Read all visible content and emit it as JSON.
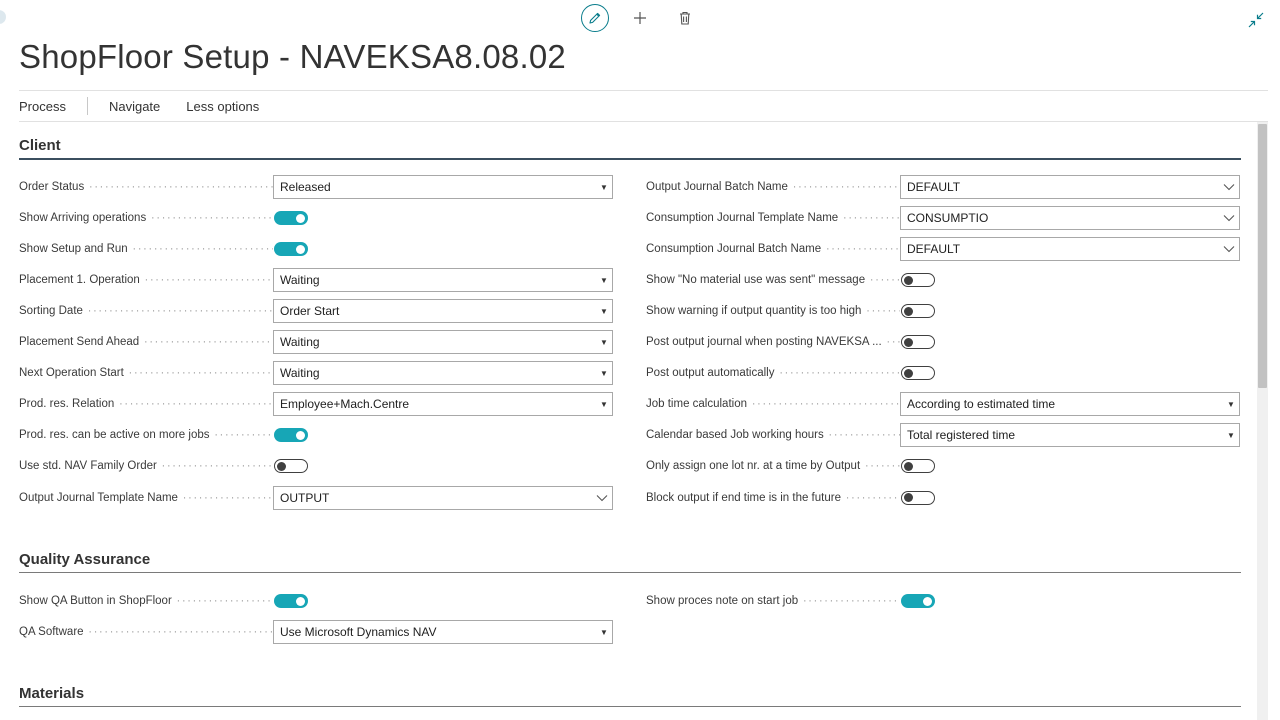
{
  "page": {
    "title": "ShopFloor Setup - NAVEKSA8.08.02"
  },
  "actions": {
    "edit": "edit-icon",
    "new": "plus-icon",
    "delete": "trash-icon",
    "collapse": "collapse-icon"
  },
  "menu": {
    "process": "Process",
    "navigate": "Navigate",
    "less_options": "Less options"
  },
  "colors": {
    "accent": "#17a6b6",
    "section_rule": "#3b4f5f"
  },
  "client": {
    "title": "Client",
    "left": [
      {
        "label": "Order Status",
        "type": "select",
        "value": "Released"
      },
      {
        "label": "Show Arriving operations",
        "type": "toggle",
        "value": "on"
      },
      {
        "label": "Show Setup and Run",
        "type": "toggle",
        "value": "on"
      },
      {
        "label": "Placement 1. Operation",
        "type": "select",
        "value": "Waiting"
      },
      {
        "label": "Sorting Date",
        "type": "select",
        "value": "Order Start"
      },
      {
        "label": "Placement Send Ahead",
        "type": "select",
        "value": "Waiting"
      },
      {
        "label": "Next Operation Start",
        "type": "select",
        "value": "Waiting"
      },
      {
        "label": "Prod. res. Relation",
        "type": "select",
        "value": "Employee+Mach.Centre"
      },
      {
        "label": "Prod. res. can be active on more jobs",
        "type": "toggle",
        "value": "on"
      },
      {
        "label": "Use std. NAV Family Order",
        "type": "toggle",
        "value": "off"
      },
      {
        "label": "Output Journal Template Name",
        "type": "lookup",
        "value": "OUTPUT"
      }
    ],
    "right": [
      {
        "label": "Output Journal Batch Name",
        "type": "lookup",
        "value": "DEFAULT"
      },
      {
        "label": "Consumption Journal Template Name",
        "type": "lookup",
        "value": "CONSUMPTIO"
      },
      {
        "label": "Consumption Journal Batch Name",
        "type": "lookup",
        "value": "DEFAULT"
      },
      {
        "label": "Show \"No material use was sent\" message",
        "type": "toggle",
        "value": "off"
      },
      {
        "label": "Show warning if output quantity is too high",
        "type": "toggle",
        "value": "off"
      },
      {
        "label": "Post output journal when posting NAVEKSA ...",
        "type": "toggle",
        "value": "off"
      },
      {
        "label": "Post output automatically",
        "type": "toggle",
        "value": "off"
      },
      {
        "label": "Job time calculation",
        "type": "select",
        "value": "According to estimated time"
      },
      {
        "label": "Calendar based Job working hours",
        "type": "select",
        "value": "Total registered time"
      },
      {
        "label": "Only assign one lot nr. at a time by Output",
        "type": "toggle",
        "value": "off"
      },
      {
        "label": "Block output if end time is in the future",
        "type": "toggle",
        "value": "off"
      }
    ]
  },
  "qa": {
    "title": "Quality Assurance",
    "left": [
      {
        "label": "Show QA Button in ShopFloor",
        "type": "toggle",
        "value": "on"
      },
      {
        "label": "QA Software",
        "type": "select",
        "value": "Use Microsoft Dynamics NAV"
      }
    ],
    "right": [
      {
        "label": "Show proces note on start job",
        "type": "toggle",
        "value": "on"
      }
    ]
  },
  "materials": {
    "title": "Materials"
  }
}
